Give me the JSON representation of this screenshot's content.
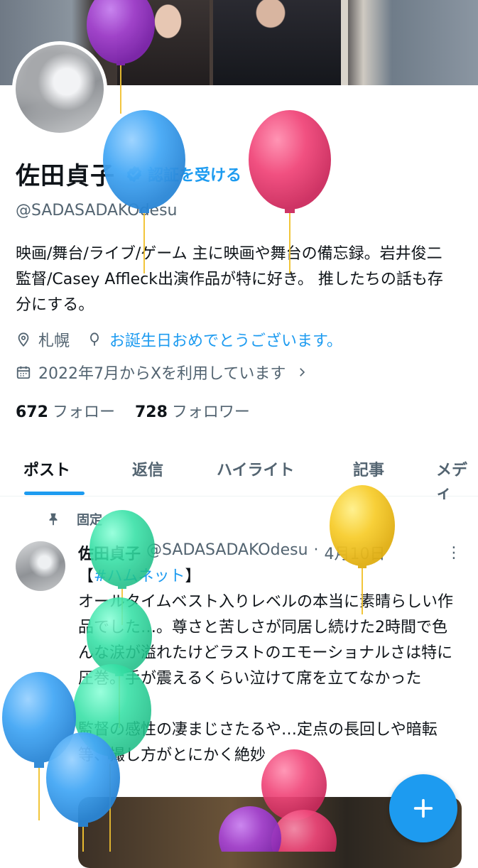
{
  "profile": {
    "display_name": "佐田貞子",
    "verify_label": "認証を受ける",
    "handle": "@SADASADAKOdesu",
    "bio": "映画/舞台/ライブ/ゲーム 主に映画や舞台の備忘録。岩井俊二監督/Casey Affleck出演作品が特に好き。 推したちの話も存分にする。",
    "location": "札幌",
    "birthday_text": "お誕生日おめでとうございます。",
    "joined": "2022年7月からXを利用しています",
    "following_count": "672",
    "following_label": "フォロー",
    "followers_count": "728",
    "followers_label": "フォロワー"
  },
  "tabs": [
    {
      "label": "ポスト"
    },
    {
      "label": "返信"
    },
    {
      "label": "ハイライト"
    },
    {
      "label": "記事"
    },
    {
      "label": "メディ"
    }
  ],
  "pinned_post": {
    "pinned_label": "固定",
    "author_name": "佐田貞子",
    "author_handle": "@SADASADAKOdesu",
    "separator": "·",
    "date": "4月10日",
    "hashtag": "#ハムネット",
    "hashtag_open": "【",
    "hashtag_close": "】",
    "text_1": "オールタイムベスト入りレベルの本当に素晴らしい作品でした…。尊さと苦しさが同居し続けた2時間で色んな涙が溢れたけどラストのエモーショナルさは特に圧巻。手が震えるくらい泣けて席を立てなかった",
    "text_2": "監督の感性の凄まじさたるや…定点の長回しや暗転等、撮し方がとにかく絶妙"
  },
  "compose_button": {
    "icon": "plus-icon"
  },
  "colors": {
    "accent": "#1d9bf0",
    "text": "#0f1419",
    "secondary": "#536471",
    "balloon_blue": "#45a8f5",
    "balloon_pink": "#f0477a",
    "balloon_purple": "#a945d6",
    "balloon_yellow": "#f7cd2e",
    "balloon_green": "#35e0a5"
  }
}
